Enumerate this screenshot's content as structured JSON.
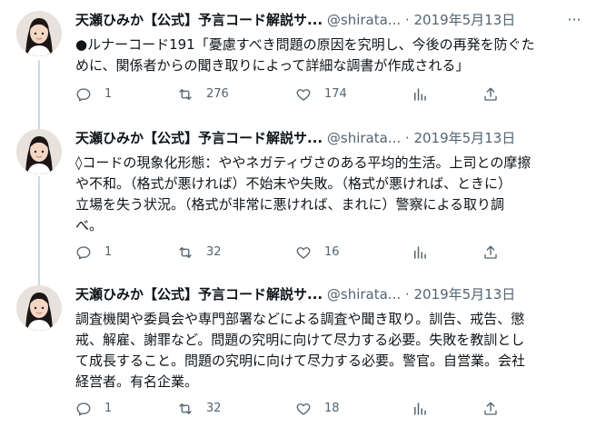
{
  "tweets": [
    {
      "name": "天瀬ひみか【公式】予言コード解説サ...",
      "handle": "@shirata...",
      "dot": "·",
      "date": "2019年5月13日",
      "more": "···",
      "text": "●ルナーコード191「憂慮すべき問題の原因を究明し、今後の再発を防ぐた\nめに、関係者からの聞き取りによって詳細な調書が作成される」",
      "replies": "1",
      "retweets": "276",
      "likes": "174"
    },
    {
      "name": "天瀬ひみか【公式】予言コード解説サ...",
      "handle": "@shirata...",
      "dot": "·",
      "date": "2019年5月13日",
      "more": "···",
      "text": "◊コードの現象化形態：ややネガティヴさのある平均的生活。上司との摩擦\nや不和。（格式が悪ければ）不始末や失敗。（格式が悪ければ、ときに）\n立場を失う状況。（格式が非常に悪ければ、まれに）警察による取り調\nべ。",
      "replies": "1",
      "retweets": "32",
      "likes": "16"
    },
    {
      "name": "天瀬ひみか【公式】予言コード解説サ...",
      "handle": "@shirata...",
      "dot": "·",
      "date": "2019年5月13日",
      "more": "···",
      "text": "調査機関や委員会や専門部署などによる調査や聞き取り。訓告、戒告、懲\n戒、解雇、謝罪など。問題の究明に向けて尽力する必要。失敗を教訓とし\nて成長すること。問題の究明に向けて尽力する必要。警官。自営業。会社\n経営者。有名企業。",
      "replies": "1",
      "retweets": "32",
      "likes": "18"
    }
  ],
  "icons": {
    "reply": "reply-icon",
    "retweet": "retweet-icon",
    "like": "like-icon",
    "analytics": "analytics-icon",
    "share": "share-icon",
    "more": "more-icon"
  },
  "colors": {
    "text": "#0f1419",
    "secondary": "#536471",
    "thread_line": "#cfd9de"
  }
}
